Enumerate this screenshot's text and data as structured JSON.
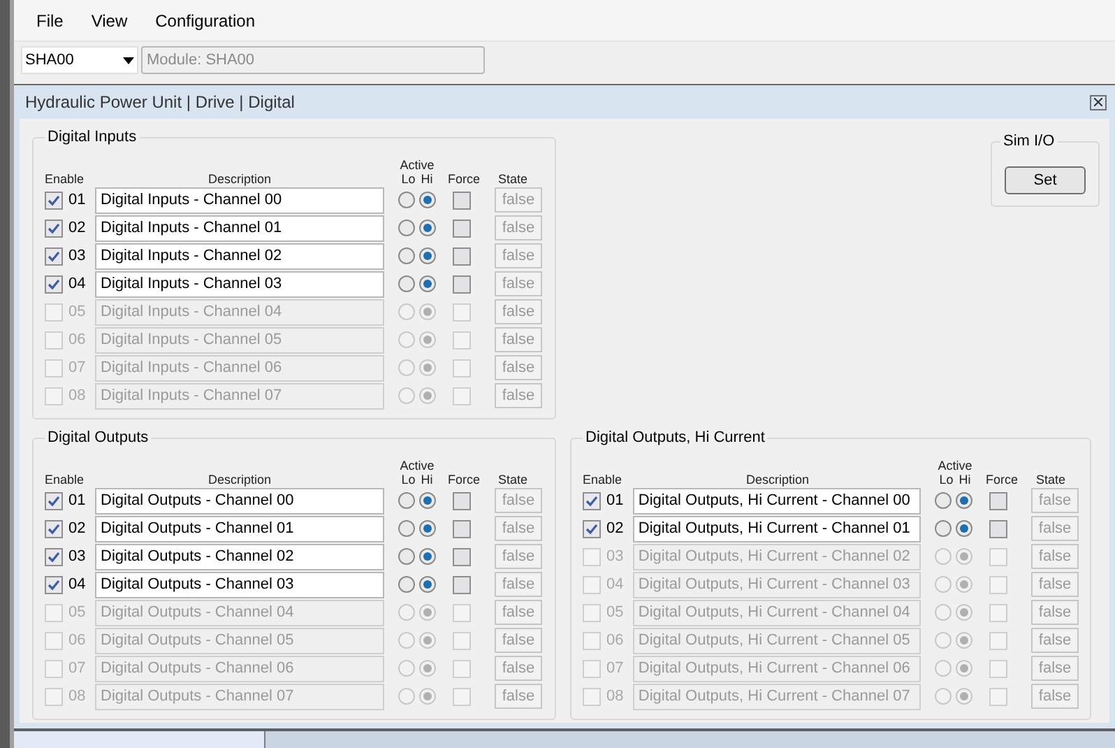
{
  "menu": [
    "File",
    "View",
    "Configuration"
  ],
  "module_select": {
    "value": "SHA00"
  },
  "module_field": {
    "value": "Module: SHA00"
  },
  "panel": {
    "title": "Hydraulic Power Unit | Drive | Digital"
  },
  "sim_io": {
    "title": "Sim I/O",
    "button": "Set"
  },
  "groups": [
    {
      "title": "Digital Inputs",
      "headers": {
        "enable": "Enable",
        "description": "Description",
        "active": "Active",
        "lo": "Lo",
        "hi": "Hi",
        "force": "Force",
        "state": "State"
      },
      "rows": [
        {
          "num": "01",
          "description": "Digital Inputs - Channel 00",
          "enabled": true,
          "lo_selected": false,
          "hi_selected": true,
          "forced": false,
          "state": "false"
        },
        {
          "num": "02",
          "description": "Digital Inputs - Channel 01",
          "enabled": true,
          "lo_selected": false,
          "hi_selected": true,
          "forced": false,
          "state": "false"
        },
        {
          "num": "03",
          "description": "Digital Inputs - Channel 02",
          "enabled": true,
          "lo_selected": false,
          "hi_selected": true,
          "forced": false,
          "state": "false"
        },
        {
          "num": "04",
          "description": "Digital Inputs - Channel 03",
          "enabled": true,
          "lo_selected": false,
          "hi_selected": true,
          "forced": false,
          "state": "false"
        },
        {
          "num": "05",
          "description": "Digital Inputs - Channel 04",
          "enabled": false,
          "lo_selected": false,
          "hi_selected": true,
          "forced": false,
          "state": "false"
        },
        {
          "num": "06",
          "description": "Digital Inputs - Channel 05",
          "enabled": false,
          "lo_selected": false,
          "hi_selected": true,
          "forced": false,
          "state": "false"
        },
        {
          "num": "07",
          "description": "Digital Inputs - Channel 06",
          "enabled": false,
          "lo_selected": false,
          "hi_selected": true,
          "forced": false,
          "state": "false"
        },
        {
          "num": "08",
          "description": "Digital Inputs - Channel 07",
          "enabled": false,
          "lo_selected": false,
          "hi_selected": true,
          "forced": false,
          "state": "false"
        }
      ]
    },
    {
      "title": "Digital Outputs",
      "headers": {
        "enable": "Enable",
        "description": "Description",
        "active": "Active",
        "lo": "Lo",
        "hi": "Hi",
        "force": "Force",
        "state": "State"
      },
      "rows": [
        {
          "num": "01",
          "description": "Digital Outputs - Channel 00",
          "enabled": true,
          "lo_selected": false,
          "hi_selected": true,
          "forced": false,
          "state": "false"
        },
        {
          "num": "02",
          "description": "Digital Outputs - Channel 01",
          "enabled": true,
          "lo_selected": false,
          "hi_selected": true,
          "forced": false,
          "state": "false"
        },
        {
          "num": "03",
          "description": "Digital Outputs - Channel 02",
          "enabled": true,
          "lo_selected": false,
          "hi_selected": true,
          "forced": false,
          "state": "false"
        },
        {
          "num": "04",
          "description": "Digital Outputs - Channel 03",
          "enabled": true,
          "lo_selected": false,
          "hi_selected": true,
          "forced": false,
          "state": "false"
        },
        {
          "num": "05",
          "description": "Digital Outputs - Channel 04",
          "enabled": false,
          "lo_selected": false,
          "hi_selected": true,
          "forced": false,
          "state": "false"
        },
        {
          "num": "06",
          "description": "Digital Outputs - Channel 05",
          "enabled": false,
          "lo_selected": false,
          "hi_selected": true,
          "forced": false,
          "state": "false"
        },
        {
          "num": "07",
          "description": "Digital Outputs - Channel 06",
          "enabled": false,
          "lo_selected": false,
          "hi_selected": true,
          "forced": false,
          "state": "false"
        },
        {
          "num": "08",
          "description": "Digital Outputs - Channel 07",
          "enabled": false,
          "lo_selected": false,
          "hi_selected": true,
          "forced": false,
          "state": "false"
        }
      ]
    },
    {
      "title": "Digital Outputs, Hi Current",
      "headers": {
        "enable": "Enable",
        "description": "Description",
        "active": "Active",
        "lo": "Lo",
        "hi": "Hi",
        "force": "Force",
        "state": "State"
      },
      "rows": [
        {
          "num": "01",
          "description": "Digital Outputs, Hi Current - Channel 00",
          "enabled": true,
          "lo_selected": false,
          "hi_selected": true,
          "forced": false,
          "state": "false"
        },
        {
          "num": "02",
          "description": "Digital Outputs, Hi Current - Channel 01",
          "enabled": true,
          "lo_selected": false,
          "hi_selected": true,
          "forced": false,
          "state": "false"
        },
        {
          "num": "03",
          "description": "Digital Outputs, Hi Current - Channel 02",
          "enabled": false,
          "lo_selected": false,
          "hi_selected": true,
          "forced": false,
          "state": "false"
        },
        {
          "num": "04",
          "description": "Digital Outputs, Hi Current - Channel 03",
          "enabled": false,
          "lo_selected": false,
          "hi_selected": true,
          "forced": false,
          "state": "false"
        },
        {
          "num": "05",
          "description": "Digital Outputs, Hi Current - Channel 04",
          "enabled": false,
          "lo_selected": false,
          "hi_selected": true,
          "forced": false,
          "state": "false"
        },
        {
          "num": "06",
          "description": "Digital Outputs, Hi Current - Channel 05",
          "enabled": false,
          "lo_selected": false,
          "hi_selected": true,
          "forced": false,
          "state": "false"
        },
        {
          "num": "07",
          "description": "Digital Outputs, Hi Current - Channel 06",
          "enabled": false,
          "lo_selected": false,
          "hi_selected": true,
          "forced": false,
          "state": "false"
        },
        {
          "num": "08",
          "description": "Digital Outputs, Hi Current - Channel 07",
          "enabled": false,
          "lo_selected": false,
          "hi_selected": true,
          "forced": false,
          "state": "false"
        }
      ]
    }
  ]
}
